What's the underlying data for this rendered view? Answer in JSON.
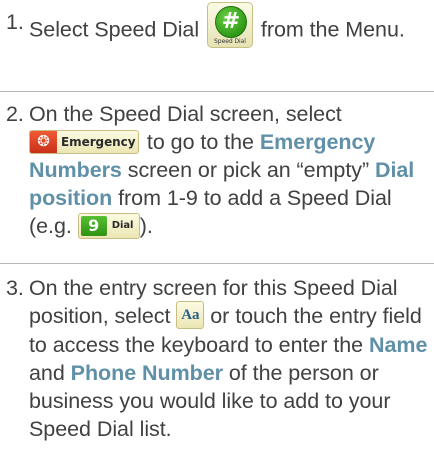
{
  "steps": [
    {
      "number": "1.",
      "parts": {
        "t1": "Select Speed Dial ",
        "icon_caption": "Speed Dial",
        "icon_symbol": "#",
        "t2": " from the Menu."
      }
    },
    {
      "number": "2.",
      "parts": {
        "t1": "On the Speed Dial screen, select ",
        "emergency_label": "Emergency",
        "t2": " to go to the ",
        "bold1": "Emergency Numbers",
        "t3": " screen or pick an “empty” ",
        "bold2": "Dial position",
        "t4": " from 1-9 to add a Speed Dial (e.g. ",
        "dial_number": "9",
        "dial_label": "Dial",
        "t5": ")."
      }
    },
    {
      "number": "3.",
      "parts": {
        "t1": "On the entry screen for this Speed Dial position, select ",
        "aa_label": "Aa",
        "t2": " or touch the entry field to access the keyboard to enter the ",
        "bold1": "Name",
        "t3": " and ",
        "bold2": "Phone Number",
        "t4": " of the person or business you would like to add to your Speed Dial list."
      }
    }
  ],
  "colors": {
    "text": "#414141",
    "highlight": "#5f90a8",
    "divider": "#b9b9b9"
  },
  "icons": {
    "speed_dial": "speed-dial-icon",
    "emergency": "emergency-icon",
    "dial": "dial-position-icon",
    "keyboard": "keyboard-aa-icon"
  }
}
